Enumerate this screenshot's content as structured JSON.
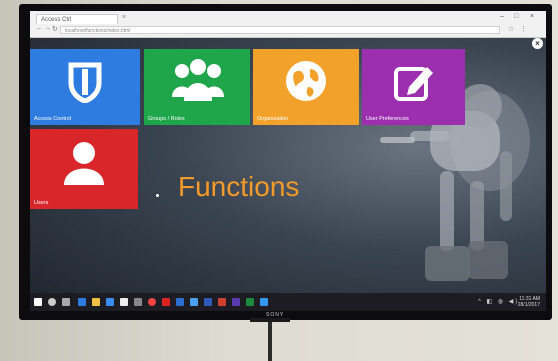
{
  "browser": {
    "tab_title": "Access Ctrl",
    "address": "localhost/functions/index.html",
    "close_label": "×"
  },
  "tiles": [
    {
      "label": "Access Control",
      "color": "#2f7ce0",
      "icon": "shield-icon"
    },
    {
      "label": "Groups / Roles",
      "color": "#1fa54a",
      "icon": "group-icon"
    },
    {
      "label": "Organization",
      "color": "#f2a12a",
      "icon": "globe-icon"
    },
    {
      "label": "User Preferences",
      "color": "#9b2fae",
      "icon": "edit-icon"
    },
    {
      "label": "Users",
      "color": "#d9262b",
      "icon": "user-icon"
    }
  ],
  "heading": "Functions",
  "taskbar": {
    "time": "11:31 AM",
    "date": "28/1/2017"
  },
  "monitor": {
    "brand": "SONY"
  }
}
